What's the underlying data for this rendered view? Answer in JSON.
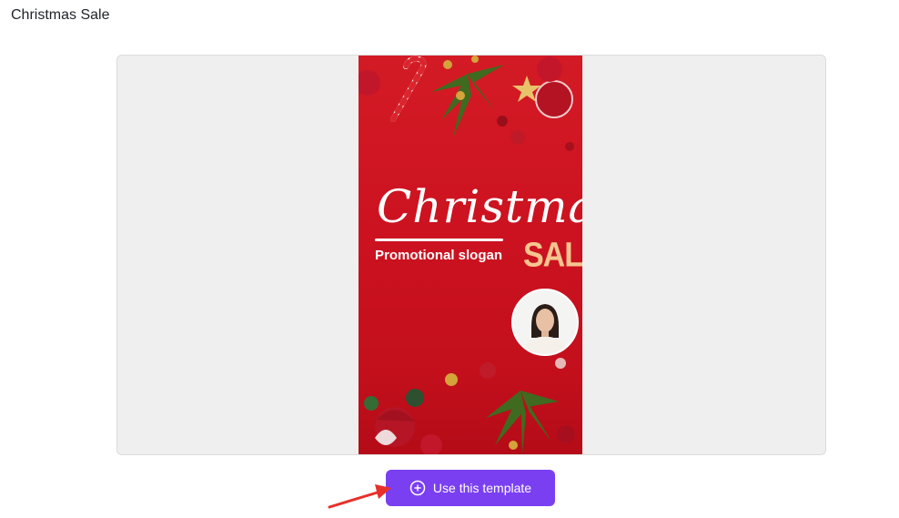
{
  "page": {
    "title": "Christmas Sale"
  },
  "template": {
    "headline": "Christmas",
    "slogan": "Promotional slogan",
    "badge": "SALE",
    "presenter_icon": "presenter-avatar"
  },
  "actions": {
    "use_template_label": "Use this template",
    "use_template_icon": "plus-circle-icon"
  },
  "colors": {
    "accent": "#7b3ff2",
    "card_red": "#d31b25",
    "sale_gold": "#f6c58f",
    "annotation_arrow": "#e8302a"
  }
}
